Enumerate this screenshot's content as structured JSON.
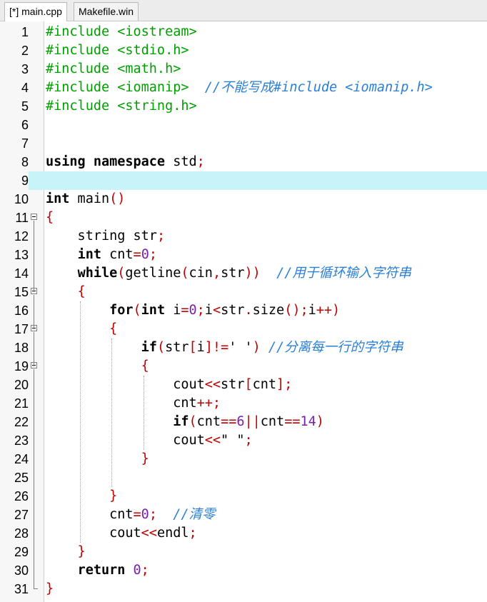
{
  "tabs": [
    {
      "label": "[*] main.cpp",
      "active": true
    },
    {
      "label": "Makefile.win",
      "active": false
    }
  ],
  "current_line": 9,
  "colors": {
    "preprocessor": "#00a000",
    "symbol": "#c00000",
    "number": "#7a20b0",
    "comment": "#2a7fd5",
    "current_line": "#c8f3f8"
  },
  "lines": [
    {
      "n": "1",
      "tokens": [
        [
          "pp",
          "#include <iostream>"
        ]
      ]
    },
    {
      "n": "2",
      "tokens": [
        [
          "pp",
          "#include <stdio.h>"
        ]
      ]
    },
    {
      "n": "3",
      "tokens": [
        [
          "pp",
          "#include <math.h>"
        ]
      ]
    },
    {
      "n": "4",
      "tokens": [
        [
          "pp",
          "#include <iomanip>"
        ],
        [
          "t",
          "  "
        ],
        [
          "cm",
          "//不能写成#include <iomanip.h>"
        ]
      ]
    },
    {
      "n": "5",
      "tokens": [
        [
          "pp",
          "#include <string.h>"
        ]
      ]
    },
    {
      "n": "6",
      "tokens": []
    },
    {
      "n": "7",
      "tokens": []
    },
    {
      "n": "8",
      "tokens": [
        [
          "kw",
          "using namespace"
        ],
        [
          "t",
          " std"
        ],
        [
          "sym",
          ";"
        ]
      ]
    },
    {
      "n": "9",
      "tokens": []
    },
    {
      "n": "10",
      "tokens": [
        [
          "kw",
          "int"
        ],
        [
          "t",
          " main"
        ],
        [
          "sym",
          "()"
        ]
      ]
    },
    {
      "n": "11",
      "tokens": [
        [
          "sym",
          "{"
        ]
      ],
      "fold": "open"
    },
    {
      "n": "12",
      "tokens": [
        [
          "t",
          "    string str"
        ],
        [
          "sym",
          ";"
        ]
      ]
    },
    {
      "n": "13",
      "tokens": [
        [
          "t",
          "    "
        ],
        [
          "kw",
          "int"
        ],
        [
          "t",
          " cnt"
        ],
        [
          "sym",
          "="
        ],
        [
          "num",
          "0"
        ],
        [
          "sym",
          ";"
        ]
      ]
    },
    {
      "n": "14",
      "tokens": [
        [
          "t",
          "    "
        ],
        [
          "kw",
          "while"
        ],
        [
          "sym",
          "("
        ],
        [
          "t",
          "getline"
        ],
        [
          "sym",
          "("
        ],
        [
          "t",
          "cin"
        ],
        [
          "sym",
          ","
        ],
        [
          "t",
          "str"
        ],
        [
          "sym",
          "))"
        ],
        [
          "t",
          "  "
        ],
        [
          "cm",
          "//用于循环输入字符串"
        ]
      ]
    },
    {
      "n": "15",
      "tokens": [
        [
          "t",
          "    "
        ],
        [
          "sym",
          "{"
        ]
      ],
      "fold": "open"
    },
    {
      "n": "16",
      "tokens": [
        [
          "t",
          "        "
        ],
        [
          "kw",
          "for"
        ],
        [
          "sym",
          "("
        ],
        [
          "kw",
          "int"
        ],
        [
          "t",
          " i"
        ],
        [
          "sym",
          "="
        ],
        [
          "num",
          "0"
        ],
        [
          "sym",
          ";"
        ],
        [
          "t",
          "i"
        ],
        [
          "sym",
          "<"
        ],
        [
          "t",
          "str"
        ],
        [
          "sym",
          "."
        ],
        [
          "t",
          "size"
        ],
        [
          "sym",
          "();"
        ],
        [
          "t",
          "i"
        ],
        [
          "sym",
          "++)"
        ]
      ]
    },
    {
      "n": "17",
      "tokens": [
        [
          "t",
          "        "
        ],
        [
          "sym",
          "{"
        ]
      ],
      "fold": "open"
    },
    {
      "n": "18",
      "tokens": [
        [
          "t",
          "            "
        ],
        [
          "kw",
          "if"
        ],
        [
          "sym",
          "("
        ],
        [
          "t",
          "str"
        ],
        [
          "sym",
          "["
        ],
        [
          "t",
          "i"
        ],
        [
          "sym",
          "]!="
        ],
        [
          "str",
          "' '"
        ],
        [
          "sym",
          ")"
        ],
        [
          "t",
          " "
        ],
        [
          "cm",
          "//分离每一行的字符串"
        ]
      ]
    },
    {
      "n": "19",
      "tokens": [
        [
          "t",
          "            "
        ],
        [
          "sym",
          "{"
        ]
      ],
      "fold": "open"
    },
    {
      "n": "20",
      "tokens": [
        [
          "t",
          "                cout"
        ],
        [
          "sym",
          "<<"
        ],
        [
          "t",
          "str"
        ],
        [
          "sym",
          "["
        ],
        [
          "t",
          "cnt"
        ],
        [
          "sym",
          "];"
        ]
      ]
    },
    {
      "n": "21",
      "tokens": [
        [
          "t",
          "                cnt"
        ],
        [
          "sym",
          "++;"
        ]
      ]
    },
    {
      "n": "22",
      "tokens": [
        [
          "t",
          "                "
        ],
        [
          "kw",
          "if"
        ],
        [
          "sym",
          "("
        ],
        [
          "t",
          "cnt"
        ],
        [
          "sym",
          "=="
        ],
        [
          "num",
          "6"
        ],
        [
          "sym",
          "||"
        ],
        [
          "t",
          "cnt"
        ],
        [
          "sym",
          "=="
        ],
        [
          "num",
          "14"
        ],
        [
          "sym",
          ")"
        ]
      ]
    },
    {
      "n": "23",
      "tokens": [
        [
          "t",
          "                cout"
        ],
        [
          "sym",
          "<<"
        ],
        [
          "str",
          "\" \""
        ],
        [
          "sym",
          ";"
        ]
      ]
    },
    {
      "n": "24",
      "tokens": [
        [
          "t",
          "            "
        ],
        [
          "sym",
          "}"
        ]
      ]
    },
    {
      "n": "25",
      "tokens": []
    },
    {
      "n": "26",
      "tokens": [
        [
          "t",
          "        "
        ],
        [
          "sym",
          "}"
        ]
      ]
    },
    {
      "n": "27",
      "tokens": [
        [
          "t",
          "        cnt"
        ],
        [
          "sym",
          "="
        ],
        [
          "num",
          "0"
        ],
        [
          "sym",
          ";"
        ],
        [
          "t",
          "  "
        ],
        [
          "cm",
          "//清零"
        ]
      ]
    },
    {
      "n": "28",
      "tokens": [
        [
          "t",
          "        cout"
        ],
        [
          "sym",
          "<<"
        ],
        [
          "t",
          "endl"
        ],
        [
          "sym",
          ";"
        ]
      ]
    },
    {
      "n": "29",
      "tokens": [
        [
          "t",
          "    "
        ],
        [
          "sym",
          "}"
        ]
      ]
    },
    {
      "n": "30",
      "tokens": [
        [
          "t",
          "    "
        ],
        [
          "kw",
          "return"
        ],
        [
          "t",
          " "
        ],
        [
          "num",
          "0"
        ],
        [
          "sym",
          ";"
        ]
      ]
    },
    {
      "n": "31",
      "tokens": [
        [
          "sym",
          "}"
        ]
      ]
    }
  ]
}
